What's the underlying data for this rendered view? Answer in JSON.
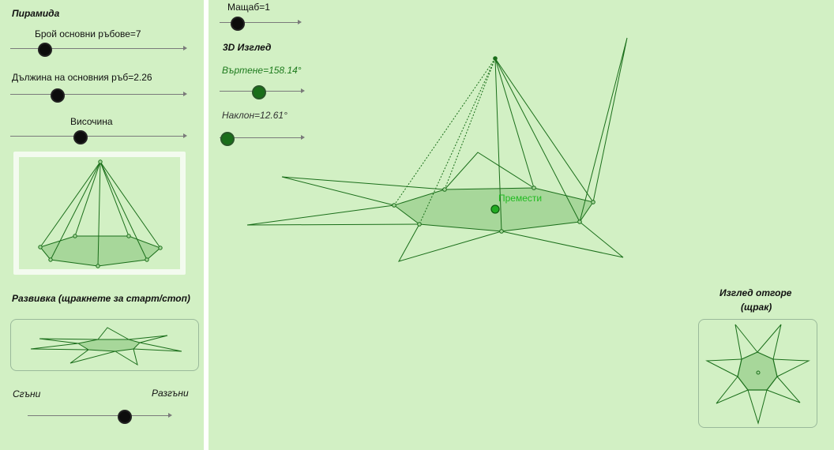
{
  "left_panel": {
    "pyramid_title": "Пирамида",
    "edges_slider": {
      "label": "Брой основни ръбове=7",
      "value": 7
    },
    "edge_length_slider": {
      "label": "Дължина на основния ръб=2.26",
      "value": 2.26
    },
    "height_slider": {
      "label": "Височина"
    },
    "net_title": "Развивка (щракнете за старт/стоп)",
    "fold_label": "Сгъни",
    "unfold_label": "Разгъни"
  },
  "right_panel": {
    "scale_slider": {
      "label": "Мащаб=1",
      "value": 1
    },
    "view_title": "3D Изглед",
    "rotation_slider": {
      "label": "Въртене=158.14°",
      "value": 158.14
    },
    "tilt_slider": {
      "label": "Наклон=12.61°",
      "value": 12.61
    },
    "move_label": "Премести",
    "top_view_title": "Изглед отгоре",
    "top_view_hint": "(щрак)"
  },
  "colors": {
    "background": "#d2f0c4",
    "line": "#1a6e1a",
    "face_fill": "#a7d79a",
    "label_green": "#1d7a1d"
  }
}
